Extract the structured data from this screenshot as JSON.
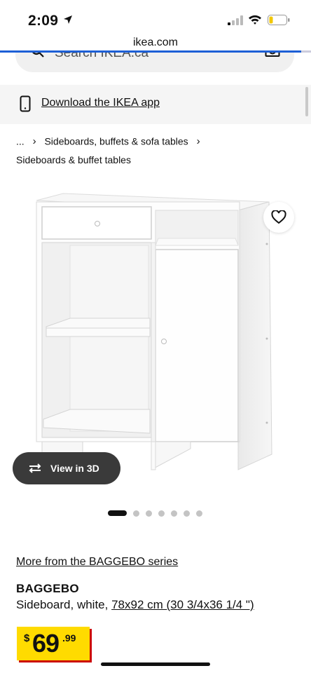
{
  "status_bar": {
    "time": "2:09"
  },
  "browser": {
    "url": "ikea.com",
    "search_placeholder": "Search IKEA.ca"
  },
  "app_banner": {
    "label": "Download the IKEA app"
  },
  "breadcrumb": {
    "ellipsis": "...",
    "parent": "Sideboards, buffets & sofa tables",
    "current": "Sideboards & buffet tables"
  },
  "gallery": {
    "view3d_label": "View in 3D",
    "image_count": 7,
    "active_index": 0
  },
  "product": {
    "series_link": "More from the BAGGEBO series",
    "name": "BAGGEBO",
    "description": "Sideboard, white, ",
    "dimensions": "78x92 cm (30 3/4x36 1/4 \")",
    "price_currency": "$",
    "price_integer": "69",
    "price_decimal": ".99"
  },
  "colors": {
    "accent_blue": "#1d5fd6",
    "price_yellow": "#ffdb00",
    "price_shadow": "#cc0008"
  }
}
